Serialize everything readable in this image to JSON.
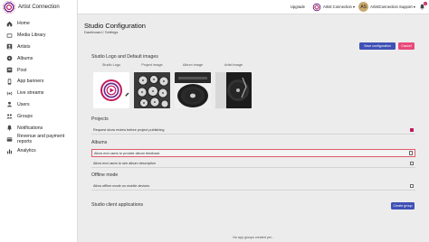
{
  "brand": {
    "name": "Artist Connection"
  },
  "sidebar": {
    "items": [
      {
        "label": "Home",
        "icon": "home-icon"
      },
      {
        "label": "Media Library",
        "icon": "media-library-icon"
      },
      {
        "label": "Artists",
        "icon": "artists-icon"
      },
      {
        "label": "Albums",
        "icon": "albums-icon"
      },
      {
        "label": "Post",
        "icon": "post-icon"
      },
      {
        "label": "App banners",
        "icon": "app-banners-icon"
      },
      {
        "label": "Live streams",
        "icon": "live-streams-icon"
      },
      {
        "label": "Users",
        "icon": "users-icon"
      },
      {
        "label": "Groups",
        "icon": "groups-icon"
      },
      {
        "label": "Notifications",
        "icon": "notifications-icon"
      },
      {
        "label": "Revenue and payment reports",
        "icon": "revenue-icon"
      },
      {
        "label": "Analytics",
        "icon": "analytics-icon"
      }
    ]
  },
  "topbar": {
    "upgrade": "Upgrade",
    "workspace": "Artist Connection",
    "user_initials": "AS",
    "user_name": "ArtistConnection Support",
    "notification_count": "1"
  },
  "page": {
    "title": "Studio Configuration",
    "breadcrumb": "Dashboard / Settings",
    "save_label": "Save configuration",
    "cancel_label": "Cancel"
  },
  "images_section": {
    "title": "Studio Logo and Default images",
    "labels": [
      "Studio Logo",
      "Project image",
      "Album image",
      "Artist image"
    ]
  },
  "projects": {
    "title": "Projects",
    "rows": [
      {
        "label": "Request show review before project publishing",
        "checked": true
      }
    ]
  },
  "albums": {
    "title": "Albums",
    "rows": [
      {
        "label": "Allow end users to provide album feedback",
        "checked": false
      },
      {
        "label": "Allow end users to see album description",
        "checked": false
      }
    ]
  },
  "offline": {
    "title": "Offline mode",
    "rows": [
      {
        "label": "Allow offline mode on mobile devices",
        "checked": false
      }
    ]
  },
  "client_apps": {
    "title": "Studio client applications",
    "create_label": "Create group",
    "empty": "No app groups created yet..."
  },
  "colors": {
    "primary": "#3f51b5",
    "accent": "#e84a7b",
    "highlight_border": "#e05a6a"
  }
}
